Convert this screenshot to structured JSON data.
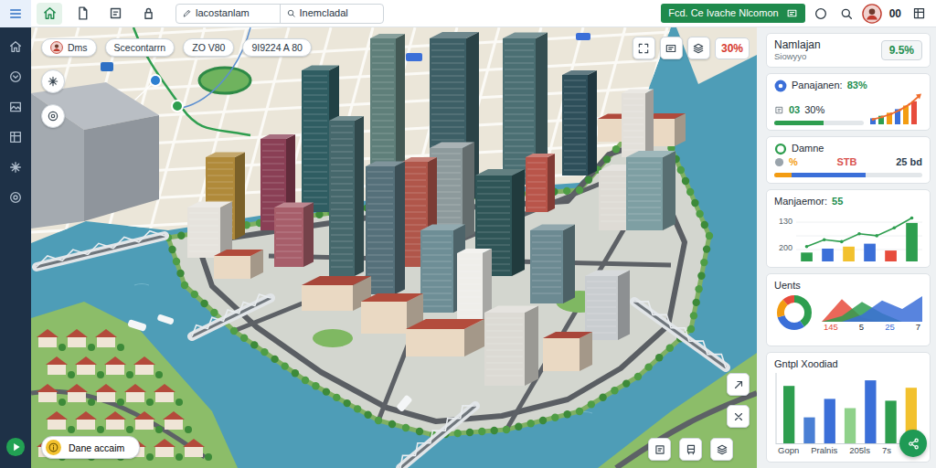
{
  "sidebar": {
    "items": [
      {
        "selected": true
      },
      {
        "selected": false
      },
      {
        "selected": false
      },
      {
        "selected": false
      },
      {
        "selected": false
      },
      {
        "selected": false
      },
      {
        "selected": false
      }
    ]
  },
  "toolbar": {
    "tabs": [
      {
        "selected": true
      },
      {
        "selected": false
      },
      {
        "selected": false
      },
      {
        "selected": false
      }
    ],
    "fields": [
      {
        "value": "lacostanlam"
      },
      {
        "value": "Inemcladal"
      }
    ],
    "action": {
      "label": "Fcd. Ce Ivache Nlcomon"
    },
    "user": {
      "label": "00"
    }
  },
  "map": {
    "chips": [
      {
        "label": "Dms"
      },
      {
        "label": "Scecontarrn"
      },
      {
        "label": "ZO V80"
      },
      {
        "label": "9I9224 A 80"
      }
    ],
    "zoom": {
      "label": "30%"
    },
    "location": {
      "label": "Dane accaim"
    }
  },
  "panel": {
    "summary": {
      "title": "Namlajan",
      "subtitle": "Siowyyo",
      "badge": "9.5%"
    },
    "progress": {
      "label": "Panajanen:",
      "value": "83%",
      "count": "03",
      "share": "30%",
      "level": 0.55,
      "bars": [
        {
          "value": 10,
          "color": "#3b6fd8"
        },
        {
          "value": 14,
          "color": "#2e9e4f"
        },
        {
          "value": 19,
          "color": "#f39c12"
        },
        {
          "value": 25,
          "color": "#3b6fd8"
        },
        {
          "value": 31,
          "color": "#f39c12"
        },
        {
          "value": 38,
          "color": "#e74c3c"
        }
      ],
      "line": [
        8,
        12,
        17,
        24,
        33,
        46
      ]
    },
    "status": {
      "title": "Damne",
      "stats": [
        {
          "text": "%",
          "color": "#f39c12"
        },
        {
          "text": "STB",
          "color": "#d9534f"
        },
        {
          "text": "25 bd",
          "color": "#2c3e50"
        }
      ],
      "segments": [
        {
          "level": 0.12,
          "color": "#f39c12"
        },
        {
          "level": 0.5,
          "color": "#3b6fd8"
        }
      ]
    },
    "trend": {
      "label": "Manjaemor:",
      "value": "55",
      "ticks": [
        "130",
        "200"
      ],
      "bars": [
        {
          "value": 18,
          "color": "#2e9e4f"
        },
        {
          "value": 26,
          "color": "#3b6fd8"
        },
        {
          "value": 30,
          "color": "#f2c12e"
        },
        {
          "value": 36,
          "color": "#3b6fd8"
        },
        {
          "value": 22,
          "color": "#e74c3c"
        },
        {
          "value": 78,
          "color": "#2e9e4f"
        }
      ],
      "line": [
        30,
        44,
        40,
        56,
        52,
        68,
        88
      ]
    },
    "users": {
      "title": "Uents",
      "donut": [
        {
          "value": 40,
          "color": "#2e9e4f"
        },
        {
          "value": 30,
          "color": "#3b6fd8"
        },
        {
          "value": 18,
          "color": "#f39c12"
        },
        {
          "value": 12,
          "color": "#e74c3c"
        }
      ],
      "areas": [
        {
          "values": [
            0,
            32,
            6,
            0,
            0,
            0
          ],
          "color": "#e74c3c"
        },
        {
          "values": [
            0,
            8,
            28,
            12,
            0,
            0
          ],
          "color": "#2e9e4f"
        },
        {
          "values": [
            0,
            0,
            10,
            30,
            18,
            36
          ],
          "color": "#3b6fd8"
        }
      ],
      "labels": [
        {
          "text": "145",
          "color": "#e74c3c"
        },
        {
          "text": "5",
          "color": "#1d2b36"
        },
        {
          "text": "25",
          "color": "#3b6fd8"
        },
        {
          "text": "7",
          "color": "#1d2b36"
        }
      ]
    },
    "output": {
      "title": "Gntpl Xoodiad",
      "bars": [
        {
          "value": 62,
          "color": "#2e9e4f"
        },
        {
          "value": 28,
          "color": "#4a7fd4"
        },
        {
          "value": 48,
          "color": "#3b6fd8"
        },
        {
          "value": 38,
          "color": "#8fd18a"
        },
        {
          "value": 68,
          "color": "#3b6fd8"
        },
        {
          "value": 46,
          "color": "#2e9e4f"
        },
        {
          "value": 60,
          "color": "#f2c12e"
        }
      ],
      "labels": [
        "Gopn",
        "Pralnis",
        "205ls",
        "7s"
      ]
    }
  }
}
